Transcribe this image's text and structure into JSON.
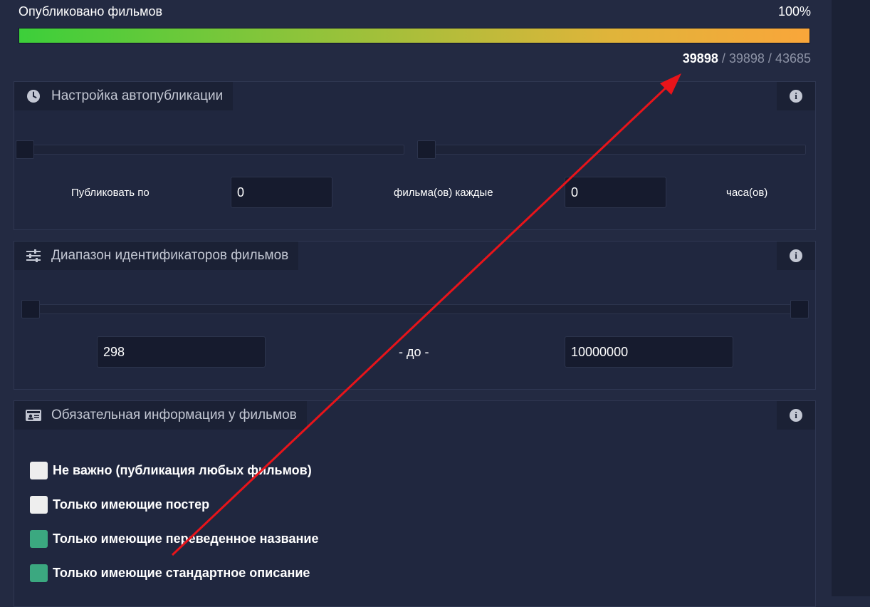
{
  "progress": {
    "title": "Опубликовано фильмов",
    "percent_text": "100%",
    "fill_fraction": 1.0,
    "current": "39898",
    "sep1": " / ",
    "published": "39898",
    "sep2": " / ",
    "total": "43685"
  },
  "autopublish": {
    "title": "Настройка автопубликации",
    "icon": "clock-icon",
    "info_icon": "i",
    "label_prefix": "Публиковать по",
    "films_value": "0",
    "label_middle": "фильма(ов) каждые",
    "hours_value": "0",
    "label_suffix": "часа(ов)"
  },
  "id_range": {
    "title": "Диапазон идентификаторов фильмов",
    "icon": "sliders-icon",
    "info_icon": "i",
    "from_value": "298",
    "separator": "- до -",
    "to_value": "10000000"
  },
  "required_info": {
    "title": "Обязательная информация у фильмов",
    "icon": "id-card-icon",
    "info_icon": "i",
    "options": [
      {
        "label": "Не важно (публикация любых фильмов)",
        "checked": false
      },
      {
        "label": "Только имеющие постер",
        "checked": false
      },
      {
        "label": "Только имеющие переведенное название",
        "checked": true
      },
      {
        "label": "Только имеющие стандартное описание",
        "checked": true
      }
    ]
  },
  "colors": {
    "background": "#232a42",
    "panel": "#20273f",
    "header": "#1b2135",
    "checked": "#3ba880",
    "unchecked": "#eeeeee",
    "annotation_arrow": "#e8141a"
  }
}
